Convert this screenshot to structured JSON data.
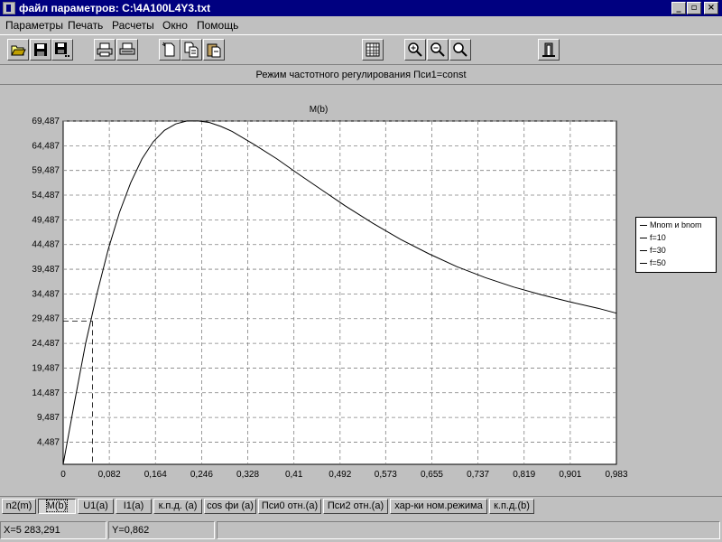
{
  "window": {
    "title": "файл параметров: C:\\4A100L4Y3.txt",
    "controls": {
      "minimize": "_",
      "maximize": "▫",
      "close": "×"
    }
  },
  "menu": [
    "Параметры",
    "Печать",
    "Расчеты",
    "Окно",
    "Помощь"
  ],
  "toolbar": {
    "icons": [
      "open-icon",
      "save-icon",
      "save-all-icon",
      "print-icon",
      "print-setup-icon",
      "new-doc-icon",
      "copy-doc-icon",
      "paste-doc-icon",
      "grid-icon",
      "zoom-in-icon",
      "zoom-out-icon",
      "zoom-fit-icon",
      "exit-icon"
    ]
  },
  "mode_title": "Режим частотного регулирования Пси1=const",
  "chart_data": {
    "type": "line",
    "title": "M(b)",
    "xlabel": "",
    "ylabel": "",
    "x_ticks": [
      "0",
      "0,082",
      "0,164",
      "0,246",
      "0,328",
      "0,41",
      "0,492",
      "0,573",
      "0,655",
      "0,737",
      "0,819",
      "0,901",
      "0,983"
    ],
    "y_ticks": [
      "4,487",
      "9,487",
      "14,487",
      "19,487",
      "24,487",
      "29,487",
      "34,487",
      "39,487",
      "44,487",
      "49,487",
      "54,487",
      "59,487",
      "64,487",
      "69,487"
    ],
    "xlim": [
      0,
      0.983
    ],
    "ylim": [
      0,
      69.487
    ],
    "grid": true,
    "legend": [
      "Mnom и bnom",
      "f=10",
      "f=30",
      "f=50"
    ],
    "legend_position": "right",
    "series": [
      {
        "name": "f=50",
        "x": [
          0,
          0.02,
          0.04,
          0.06,
          0.08,
          0.1,
          0.12,
          0.14,
          0.16,
          0.18,
          0.2,
          0.22,
          0.24,
          0.26,
          0.28,
          0.3,
          0.34,
          0.38,
          0.42,
          0.46,
          0.5,
          0.55,
          0.6,
          0.65,
          0.7,
          0.75,
          0.8,
          0.85,
          0.9,
          0.95,
          0.983
        ],
        "y": [
          0,
          12.5,
          24.5,
          34.5,
          43.5,
          51,
          57,
          61.8,
          65.3,
          67.6,
          68.9,
          69.5,
          69.5,
          69.2,
          68.4,
          67.4,
          64.7,
          61.8,
          58.6,
          55.5,
          52.4,
          48.8,
          45.5,
          42.6,
          40.0,
          37.8,
          35.9,
          34.3,
          32.9,
          31.6,
          30.6
        ]
      }
    ],
    "nominal_point": {
      "x": 0.052,
      "y": 29.0
    }
  },
  "tabs": [
    {
      "label": "n2(m)",
      "active": false
    },
    {
      "label": "M(b)",
      "active": true
    },
    {
      "label": "U1(a)",
      "active": false
    },
    {
      "label": "I1(a)",
      "active": false
    },
    {
      "label": "к.п.д. (a)",
      "active": false
    },
    {
      "label": "cos фи (a)",
      "active": false
    },
    {
      "label": "Пси0 отн.(a)",
      "active": false
    },
    {
      "label": "Пси2 отн.(a)",
      "active": false
    },
    {
      "label": "хар-ки ном.режима",
      "active": false
    },
    {
      "label": "к.п.д.(b)",
      "active": false
    }
  ],
  "status": {
    "x_readout": "X=5 283,291",
    "y_readout": "Y=0,862"
  }
}
